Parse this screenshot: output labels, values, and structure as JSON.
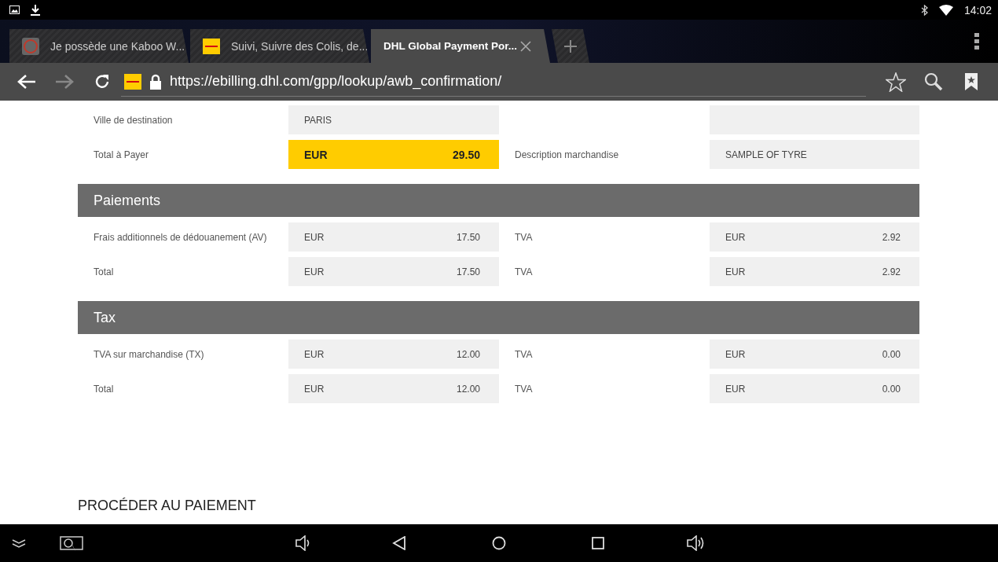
{
  "status_bar": {
    "time": "14:02"
  },
  "tabs": [
    {
      "title": "Je possède une Kaboo W...",
      "selected": false,
      "kind": "circle"
    },
    {
      "title": "Suivi, Suivre des Colis, de...",
      "selected": false,
      "kind": "dhl"
    },
    {
      "title": "DHL Global Payment Por...",
      "selected": true,
      "kind": "plain"
    }
  ],
  "address_bar": {
    "url": "https://ebilling.dhl.com/gpp/lookup/awb_confirmation/"
  },
  "page": {
    "rows": [
      {
        "label": "Ville de destination",
        "field": {
          "kind": "text",
          "value": "PARIS"
        },
        "field_2": {
          "kind": "blank"
        }
      },
      {
        "label": "Total à Payer",
        "field": {
          "kind": "amount",
          "currency": "EUR",
          "amount": "29.50",
          "highlight": true
        },
        "label_2": "Description marchandise",
        "field_2": {
          "kind": "text",
          "value": "SAMPLE OF TYRE"
        }
      }
    ],
    "sections": [
      {
        "title": "Paiements",
        "rows": [
          {
            "label": "Frais additionnels de dédouanement (AV)",
            "field": {
              "kind": "amount",
              "currency": "EUR",
              "amount": "17.50",
              "highlight": false
            },
            "label_2": "TVA",
            "field_2": {
              "kind": "amount",
              "currency": "EUR",
              "amount": "2.92",
              "highlight": false
            }
          },
          {
            "label": "Total",
            "field": {
              "kind": "amount",
              "currency": "EUR",
              "amount": "17.50",
              "highlight": false
            },
            "label_2": "TVA",
            "field_2": {
              "kind": "amount",
              "currency": "EUR",
              "amount": "2.92",
              "highlight": false
            }
          }
        ]
      },
      {
        "title": "Tax",
        "rows": [
          {
            "label": "TVA sur marchandise (TX)",
            "field": {
              "kind": "amount",
              "currency": "EUR",
              "amount": "12.00",
              "highlight": false
            },
            "label_2": "TVA",
            "field_2": {
              "kind": "amount",
              "currency": "EUR",
              "amount": "0.00",
              "highlight": false
            }
          },
          {
            "label": "Total",
            "field": {
              "kind": "amount",
              "currency": "EUR",
              "amount": "12.00",
              "highlight": false
            },
            "label_2": "TVA",
            "field_2": {
              "kind": "amount",
              "currency": "EUR",
              "amount": "0.00",
              "highlight": false
            }
          }
        ]
      }
    ],
    "heading": "PROCÉDER AU PAIEMENT"
  }
}
